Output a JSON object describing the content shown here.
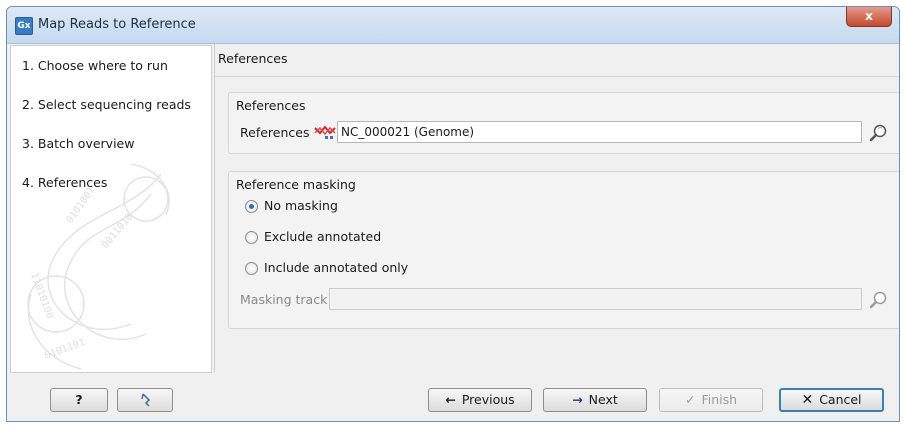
{
  "window": {
    "title": "Map Reads to Reference",
    "app_icon_text": "Gx",
    "close_glyph": "x"
  },
  "steps": [
    {
      "label": "1.  Choose where to run"
    },
    {
      "label": "2.  Select sequencing reads"
    },
    {
      "label": "3.  Batch overview"
    },
    {
      "label": "4.  References"
    }
  ],
  "main": {
    "section_title": "References",
    "references_group": {
      "title": "References",
      "field_label": "References",
      "field_value": "NC_000021 (Genome)"
    },
    "masking_group": {
      "title": "Reference masking",
      "options": [
        {
          "label": "No masking",
          "selected": true
        },
        {
          "label": "Exclude annotated",
          "selected": false
        },
        {
          "label": "Include annotated only",
          "selected": false
        }
      ],
      "track_label": "Masking track",
      "track_value": ""
    }
  },
  "footer": {
    "help_label": "?",
    "reset_icon": "undo-arrow",
    "previous_label": "Previous",
    "next_label": "Next",
    "finish_label": "Finish",
    "cancel_label": "Cancel"
  },
  "colors": {
    "titlebar": "#c6d9ef",
    "close": "#c44a32",
    "radio_selected": "#2d6fb3",
    "focus": "#3c7fb1"
  }
}
